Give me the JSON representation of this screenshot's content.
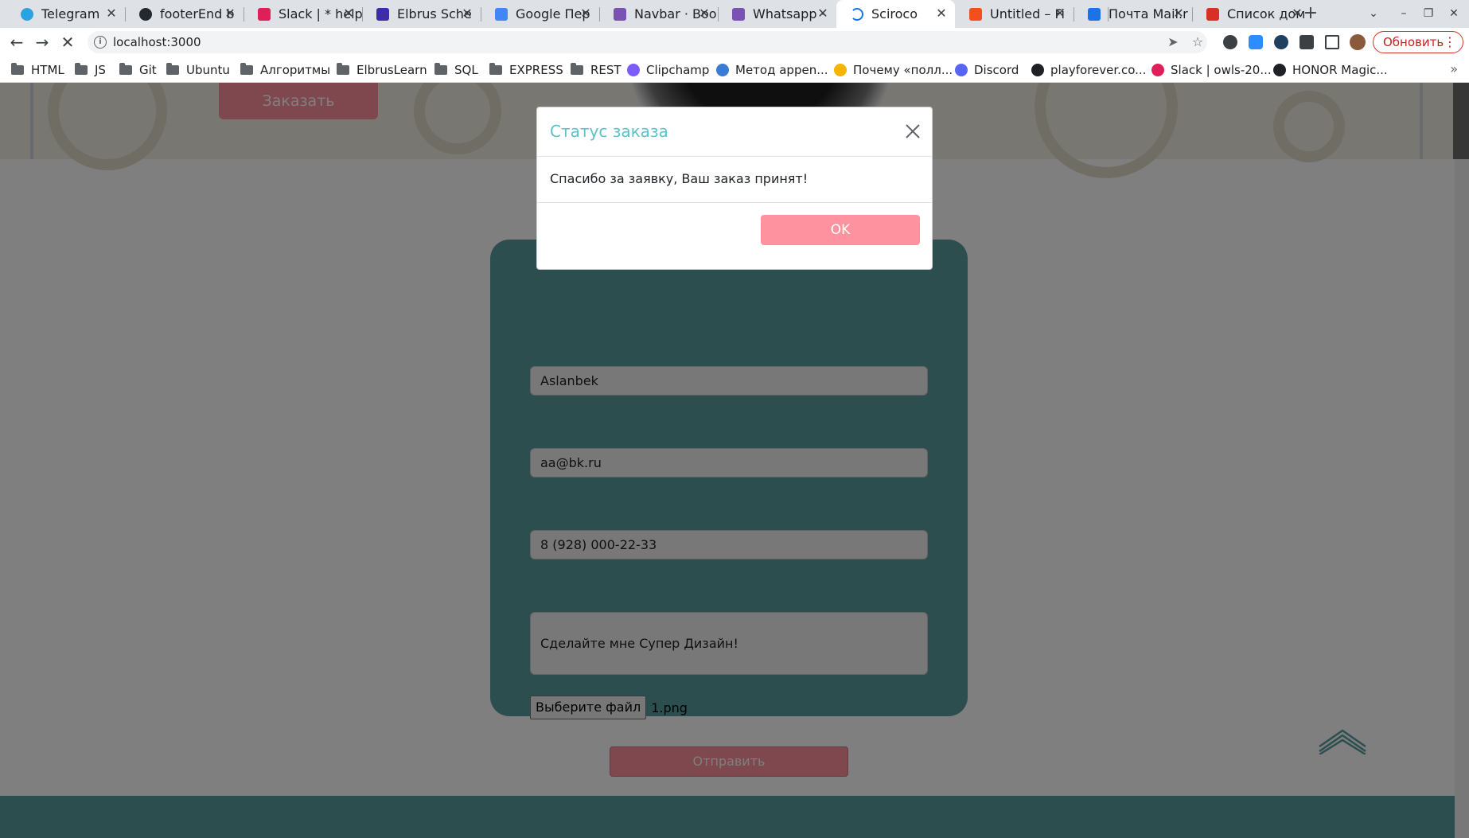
{
  "browser": {
    "tabs": [
      {
        "title": "Telegram",
        "icon": "telegram-icon",
        "color": "#2aa3e0"
      },
      {
        "title": "footerEnd b",
        "icon": "github-icon",
        "color": "#24292f"
      },
      {
        "title": "Slack | * help",
        "icon": "slack-icon",
        "color": "#e01e5a"
      },
      {
        "title": "Elbrus Sche",
        "icon": "elbrus-icon",
        "color": "#3f2aa8"
      },
      {
        "title": "Google Пер",
        "icon": "google-translate-icon",
        "color": "#4285f4"
      },
      {
        "title": "Navbar · Boo",
        "icon": "bootstrap-icon",
        "color": "#7952b3"
      },
      {
        "title": "Whatsapp · ",
        "icon": "bootstrap-icon",
        "color": "#7952b3"
      },
      {
        "title": "Sciroco",
        "icon": "loading-icon",
        "color": "#1a73e8"
      },
      {
        "title": "Untitled – Fi",
        "icon": "figma-icon",
        "color": "#f24e1e"
      },
      {
        "title": "Почта Mail.r",
        "icon": "mail-icon",
        "color": "#1a73e8"
      },
      {
        "title": "Список дом",
        "icon": "list-icon",
        "color": "#d93025"
      }
    ],
    "new_tab": "+",
    "url": "localhost:3000",
    "update_label": "Обновить",
    "bookmarks": [
      {
        "label": "HTML",
        "type": "folder"
      },
      {
        "label": "JS",
        "type": "folder"
      },
      {
        "label": "Git",
        "type": "folder"
      },
      {
        "label": "Ubuntu",
        "type": "folder"
      },
      {
        "label": "Алгоритмы",
        "type": "folder"
      },
      {
        "label": "ElbrusLearn",
        "type": "folder"
      },
      {
        "label": "SQL",
        "type": "folder"
      },
      {
        "label": "EXPRESS",
        "type": "folder"
      },
      {
        "label": "REST",
        "type": "folder"
      },
      {
        "label": "Clipchamp",
        "type": "link",
        "color": "#7b5cff"
      },
      {
        "label": "Метод appen...",
        "type": "link",
        "color": "#3a7bd5"
      },
      {
        "label": "Почему «полл...",
        "type": "link",
        "color": "#f4b400"
      },
      {
        "label": "Discord",
        "type": "link",
        "color": "#5865f2"
      },
      {
        "label": "playforever.co...",
        "type": "link",
        "color": "#202124"
      },
      {
        "label": "Slack | owls-20...",
        "type": "link",
        "color": "#e01e5a"
      },
      {
        "label": "HONOR Magic...",
        "type": "link",
        "color": "#202124"
      }
    ],
    "bookmarks_more": "»"
  },
  "page": {
    "hero_order_label": "Заказать",
    "form": {
      "name_value": "Aslanbek",
      "email_value": "aa@bk.ru",
      "phone_value": "8 (928) 000-22-33",
      "message_value": "Сделайте мне Супер Дизайн!",
      "file_button_label": "Выберите файл",
      "file_name": "1.png",
      "submit_label": "Отправить"
    }
  },
  "modal": {
    "title": "Статус заказа",
    "message": "Спасибо за заявку, Ваш заказ принят!",
    "ok_label": "OK"
  },
  "colors": {
    "accent_teal": "#5a9d9e",
    "accent_pink": "#ff8f9c",
    "modal_title": "#5ac2c8"
  }
}
